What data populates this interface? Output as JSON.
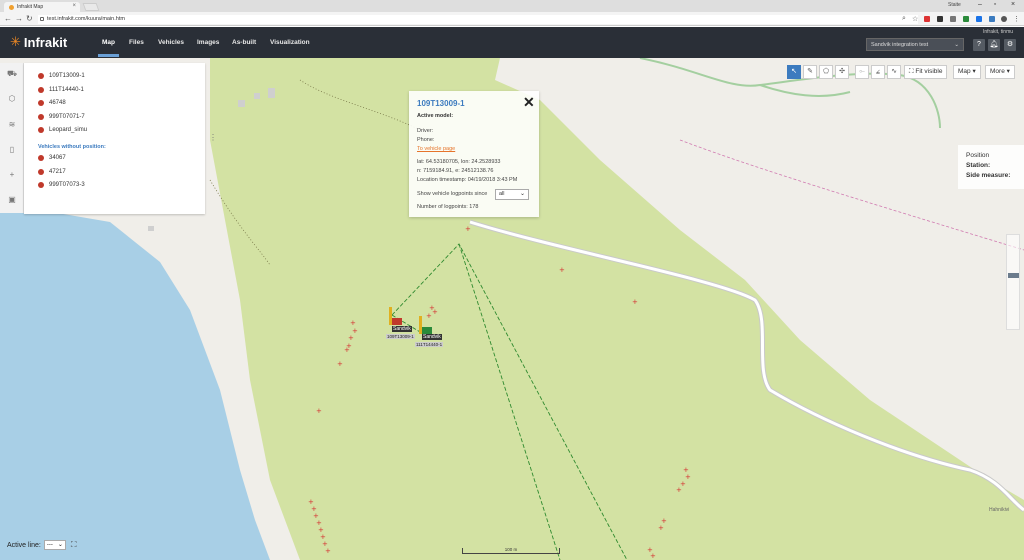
{
  "browser": {
    "tab_title": "Infrakit Map",
    "url": "test.infrakit.com/kuura/main.htm",
    "window_user": "Staite"
  },
  "app": {
    "logo_text": "Infrakit",
    "nav": [
      "Map",
      "Files",
      "Vehicles",
      "Images",
      "As-built",
      "Visualization"
    ],
    "active_nav": "Map",
    "user": "Infrakit, tinmu",
    "project": "Sandvik integration test",
    "help_label": "?"
  },
  "vehicles": {
    "with_position": [
      "109T13009-1",
      "111T14440-1",
      "46748",
      "999T07071-7",
      "Leopard_simu"
    ],
    "without_position_label": "Vehicles without position:",
    "without_position": [
      "34067",
      "47217",
      "999T07073-3"
    ],
    "dot_color": "#c0392b"
  },
  "popup": {
    "title": "109T13009-1",
    "active_model": "Active model:",
    "driver": "Driver:",
    "phone": "Phone:",
    "vehicle_link": "To vehicle page",
    "latlon": "lat: 64.53180705, lon: 24.2528933",
    "ne": "n: 7159184.91, e: 24512138.76",
    "timestamp": "Location timestamp: 04/19/2018 3:43 PM",
    "logpoints_label": "Show vehicle logpoints since",
    "logpoints_value": "all",
    "logpoints_count": "Number of logpoints: 178"
  },
  "toolbar": {
    "fit_label": "Fit visible",
    "map_label": "Map ▾",
    "more_label": "More ▾"
  },
  "position_panel": {
    "title": "Position",
    "station": "Station:",
    "side": "Side measure:"
  },
  "map": {
    "vehicle_labels": [
      "Sandvik",
      "Sandvik"
    ],
    "vehicle_ids": [
      "109T13009-1",
      "111T14440-1"
    ],
    "active_line_label": "Active line:",
    "active_line_value": "---",
    "scale_label": "100 m",
    "attribution": "Hahnikivi",
    "colors": {
      "land": "#f0eee9",
      "field": "#d3e2a3",
      "water": "#a8cfe6",
      "track": "#2f8a2f",
      "log": "#d43030"
    }
  }
}
